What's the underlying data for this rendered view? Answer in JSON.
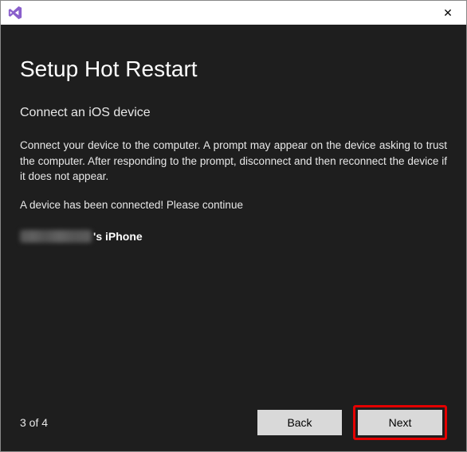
{
  "titlebar": {
    "close_glyph": "✕"
  },
  "main": {
    "title": "Setup Hot Restart",
    "subtitle": "Connect an iOS device",
    "instruction": "Connect your device to the computer. A prompt may appear on the device asking to trust the computer. After responding to the prompt, disconnect and then reconnect the device if it does not appear.",
    "status": "A device has been connected! Please continue",
    "device_suffix": "'s iPhone"
  },
  "footer": {
    "step": "3 of 4",
    "back_label": "Back",
    "next_label": "Next"
  }
}
